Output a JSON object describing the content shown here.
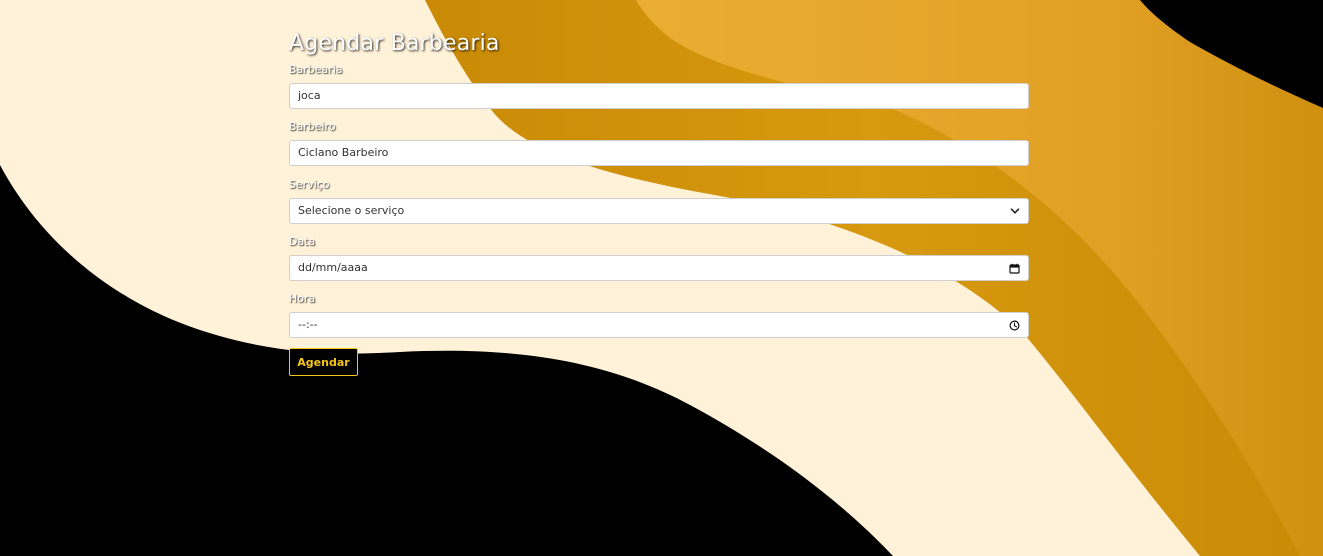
{
  "page": {
    "title": "Agendar Barbearia"
  },
  "form": {
    "barbearia": {
      "label": "Barbearia",
      "value": "joca"
    },
    "barbeiro": {
      "label": "Barbeiro",
      "value": "Ciclano Barbeiro"
    },
    "servico": {
      "label": "Serviço",
      "selected": "Selecione o serviço"
    },
    "data": {
      "label": "Data",
      "placeholder": "dd/mm/aaaa"
    },
    "hora": {
      "label": "Hora",
      "placeholder": "--:--"
    },
    "submit_label": "Agendar"
  },
  "icons": {
    "select": "chevron-down-icon",
    "date": "calendar-icon",
    "time": "clock-icon"
  },
  "colors": {
    "cream": "#fff2d8",
    "gold_dark": "#c98a06",
    "gold_light": "#eaae33",
    "black": "#000000",
    "button_text": "#f5c518"
  }
}
